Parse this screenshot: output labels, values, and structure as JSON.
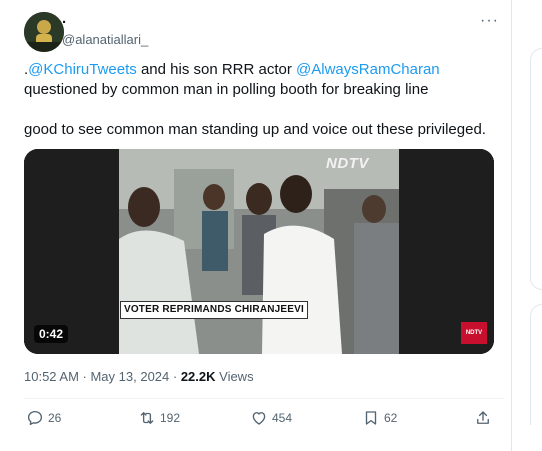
{
  "tweet": {
    "display_name": ".",
    "handle": "@alanatiallari_",
    "more_label": "···",
    "text_parts": {
      "prefix": ".",
      "mention1": "@KChiruTweets",
      "middle": " and his son RRR actor ",
      "mention2": "@AlwaysRamCharan",
      "suffix": " questioned by common man in polling booth for breaking line"
    },
    "text_line2": "good to see common man standing up and voice out these privileged.",
    "media": {
      "caption": "VOTER REPRIMANDS CHIRANJEEVI",
      "channel_logo": "NDTV",
      "badge": "NDTV",
      "duration": "0:42"
    },
    "timestamp": "10:52 AM · May 13, 2024 · ",
    "views_count": "22.2K",
    "views_label": " Views"
  },
  "actions": {
    "replies": "26",
    "reposts": "192",
    "likes": "454",
    "bookmarks": "62"
  },
  "colors": {
    "accent": "#1d9bf0",
    "text": "#0f1419",
    "muted": "#536471"
  }
}
